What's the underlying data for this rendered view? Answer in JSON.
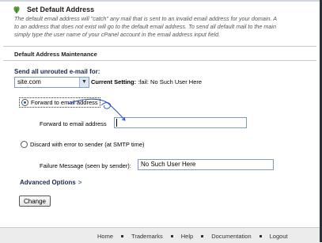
{
  "header": {
    "title": "Set Default Address",
    "icon": "default-address-icon"
  },
  "intro": {
    "line1": "The default email address will \"catch\" any mail that is sent to an invalid email address for your domain. A",
    "line2": "to an address that does not exist will go to the default email address. To send all default mail to the main",
    "line3": "simply type the user name of your cPanel account in the email address input field."
  },
  "section": {
    "title": "Default Address Maintenance"
  },
  "form": {
    "send_label": "Send all unrouted e-mail for:",
    "domain_value": "site.com",
    "current_setting_label": "Current Setting",
    "current_setting_value": ":fail: No Such User Here",
    "forward_option_label": "Forward to email address",
    "forward_field_label": "Forward to email address",
    "forward_value": "",
    "discard_option_label": "Discard with error to sender (at SMTP time)",
    "failure_label": "Failure Message (seen by sender):",
    "failure_value": "No Such User Here",
    "advanced_label": "Advanced Options",
    "advanced_chevron": ">",
    "change_button": "Change"
  },
  "footer": {
    "links": [
      "Home",
      "Trademarks",
      "Help",
      "Documentation",
      "Logout"
    ]
  },
  "colors": {
    "heading": "#1b2a4a",
    "annotation": "#2a4fd0",
    "footer_bg": "#ececec"
  }
}
